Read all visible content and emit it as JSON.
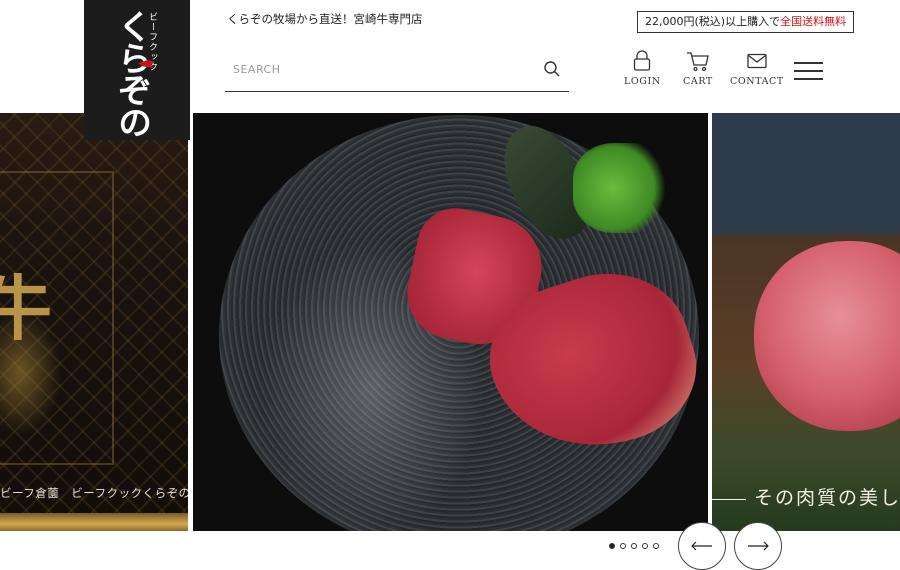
{
  "brand": {
    "logo_sub": "ビーフクック",
    "logo_main": "くらぞの"
  },
  "header": {
    "tagline": "くらぞの牧場から直送！宮崎牛専門店",
    "shipping_prefix": "22,000円(税込)以上購入で",
    "shipping_free": "全国送料無料",
    "search_placeholder": "SEARCH",
    "nav": {
      "login": "LOGIN",
      "cart": "CART",
      "contact": "CONTACT"
    }
  },
  "slider": {
    "slides": [
      {
        "caption": "ビーフ倉薗　ビーフクックくらぞの",
        "kanji": "牛"
      },
      {
        "caption": ""
      },
      {
        "caption": "その肉質の美し"
      }
    ],
    "dots_count": 5,
    "active_dot": 1
  },
  "colors": {
    "accent_red": "#d9121b",
    "logo_bg": "#1c1c1c",
    "text": "#222222"
  },
  "icons": [
    "search-icon",
    "lock-icon",
    "cart-icon",
    "mail-icon",
    "menu-icon",
    "arrow-left-icon",
    "arrow-right-icon"
  ]
}
